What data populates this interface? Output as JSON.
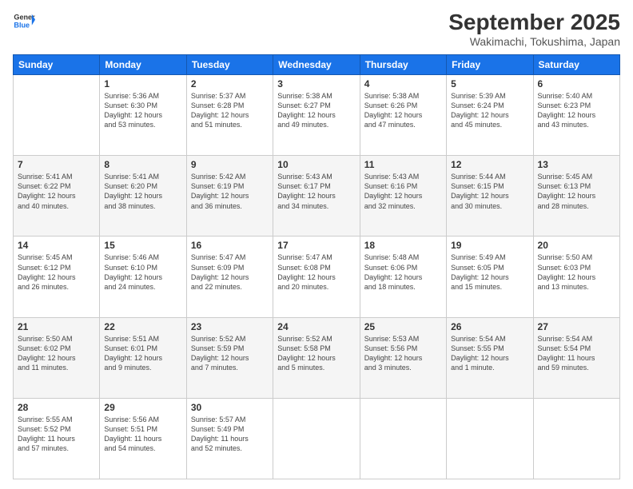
{
  "header": {
    "logo_line1": "General",
    "logo_line2": "Blue",
    "month": "September 2025",
    "location": "Wakimachi, Tokushima, Japan"
  },
  "days_of_week": [
    "Sunday",
    "Monday",
    "Tuesday",
    "Wednesday",
    "Thursday",
    "Friday",
    "Saturday"
  ],
  "weeks": [
    [
      {
        "day": "",
        "info": ""
      },
      {
        "day": "1",
        "info": "Sunrise: 5:36 AM\nSunset: 6:30 PM\nDaylight: 12 hours\nand 53 minutes."
      },
      {
        "day": "2",
        "info": "Sunrise: 5:37 AM\nSunset: 6:28 PM\nDaylight: 12 hours\nand 51 minutes."
      },
      {
        "day": "3",
        "info": "Sunrise: 5:38 AM\nSunset: 6:27 PM\nDaylight: 12 hours\nand 49 minutes."
      },
      {
        "day": "4",
        "info": "Sunrise: 5:38 AM\nSunset: 6:26 PM\nDaylight: 12 hours\nand 47 minutes."
      },
      {
        "day": "5",
        "info": "Sunrise: 5:39 AM\nSunset: 6:24 PM\nDaylight: 12 hours\nand 45 minutes."
      },
      {
        "day": "6",
        "info": "Sunrise: 5:40 AM\nSunset: 6:23 PM\nDaylight: 12 hours\nand 43 minutes."
      }
    ],
    [
      {
        "day": "7",
        "info": "Sunrise: 5:41 AM\nSunset: 6:22 PM\nDaylight: 12 hours\nand 40 minutes."
      },
      {
        "day": "8",
        "info": "Sunrise: 5:41 AM\nSunset: 6:20 PM\nDaylight: 12 hours\nand 38 minutes."
      },
      {
        "day": "9",
        "info": "Sunrise: 5:42 AM\nSunset: 6:19 PM\nDaylight: 12 hours\nand 36 minutes."
      },
      {
        "day": "10",
        "info": "Sunrise: 5:43 AM\nSunset: 6:17 PM\nDaylight: 12 hours\nand 34 minutes."
      },
      {
        "day": "11",
        "info": "Sunrise: 5:43 AM\nSunset: 6:16 PM\nDaylight: 12 hours\nand 32 minutes."
      },
      {
        "day": "12",
        "info": "Sunrise: 5:44 AM\nSunset: 6:15 PM\nDaylight: 12 hours\nand 30 minutes."
      },
      {
        "day": "13",
        "info": "Sunrise: 5:45 AM\nSunset: 6:13 PM\nDaylight: 12 hours\nand 28 minutes."
      }
    ],
    [
      {
        "day": "14",
        "info": "Sunrise: 5:45 AM\nSunset: 6:12 PM\nDaylight: 12 hours\nand 26 minutes."
      },
      {
        "day": "15",
        "info": "Sunrise: 5:46 AM\nSunset: 6:10 PM\nDaylight: 12 hours\nand 24 minutes."
      },
      {
        "day": "16",
        "info": "Sunrise: 5:47 AM\nSunset: 6:09 PM\nDaylight: 12 hours\nand 22 minutes."
      },
      {
        "day": "17",
        "info": "Sunrise: 5:47 AM\nSunset: 6:08 PM\nDaylight: 12 hours\nand 20 minutes."
      },
      {
        "day": "18",
        "info": "Sunrise: 5:48 AM\nSunset: 6:06 PM\nDaylight: 12 hours\nand 18 minutes."
      },
      {
        "day": "19",
        "info": "Sunrise: 5:49 AM\nSunset: 6:05 PM\nDaylight: 12 hours\nand 15 minutes."
      },
      {
        "day": "20",
        "info": "Sunrise: 5:50 AM\nSunset: 6:03 PM\nDaylight: 12 hours\nand 13 minutes."
      }
    ],
    [
      {
        "day": "21",
        "info": "Sunrise: 5:50 AM\nSunset: 6:02 PM\nDaylight: 12 hours\nand 11 minutes."
      },
      {
        "day": "22",
        "info": "Sunrise: 5:51 AM\nSunset: 6:01 PM\nDaylight: 12 hours\nand 9 minutes."
      },
      {
        "day": "23",
        "info": "Sunrise: 5:52 AM\nSunset: 5:59 PM\nDaylight: 12 hours\nand 7 minutes."
      },
      {
        "day": "24",
        "info": "Sunrise: 5:52 AM\nSunset: 5:58 PM\nDaylight: 12 hours\nand 5 minutes."
      },
      {
        "day": "25",
        "info": "Sunrise: 5:53 AM\nSunset: 5:56 PM\nDaylight: 12 hours\nand 3 minutes."
      },
      {
        "day": "26",
        "info": "Sunrise: 5:54 AM\nSunset: 5:55 PM\nDaylight: 12 hours\nand 1 minute."
      },
      {
        "day": "27",
        "info": "Sunrise: 5:54 AM\nSunset: 5:54 PM\nDaylight: 11 hours\nand 59 minutes."
      }
    ],
    [
      {
        "day": "28",
        "info": "Sunrise: 5:55 AM\nSunset: 5:52 PM\nDaylight: 11 hours\nand 57 minutes."
      },
      {
        "day": "29",
        "info": "Sunrise: 5:56 AM\nSunset: 5:51 PM\nDaylight: 11 hours\nand 54 minutes."
      },
      {
        "day": "30",
        "info": "Sunrise: 5:57 AM\nSunset: 5:49 PM\nDaylight: 11 hours\nand 52 minutes."
      },
      {
        "day": "",
        "info": ""
      },
      {
        "day": "",
        "info": ""
      },
      {
        "day": "",
        "info": ""
      },
      {
        "day": "",
        "info": ""
      }
    ]
  ]
}
